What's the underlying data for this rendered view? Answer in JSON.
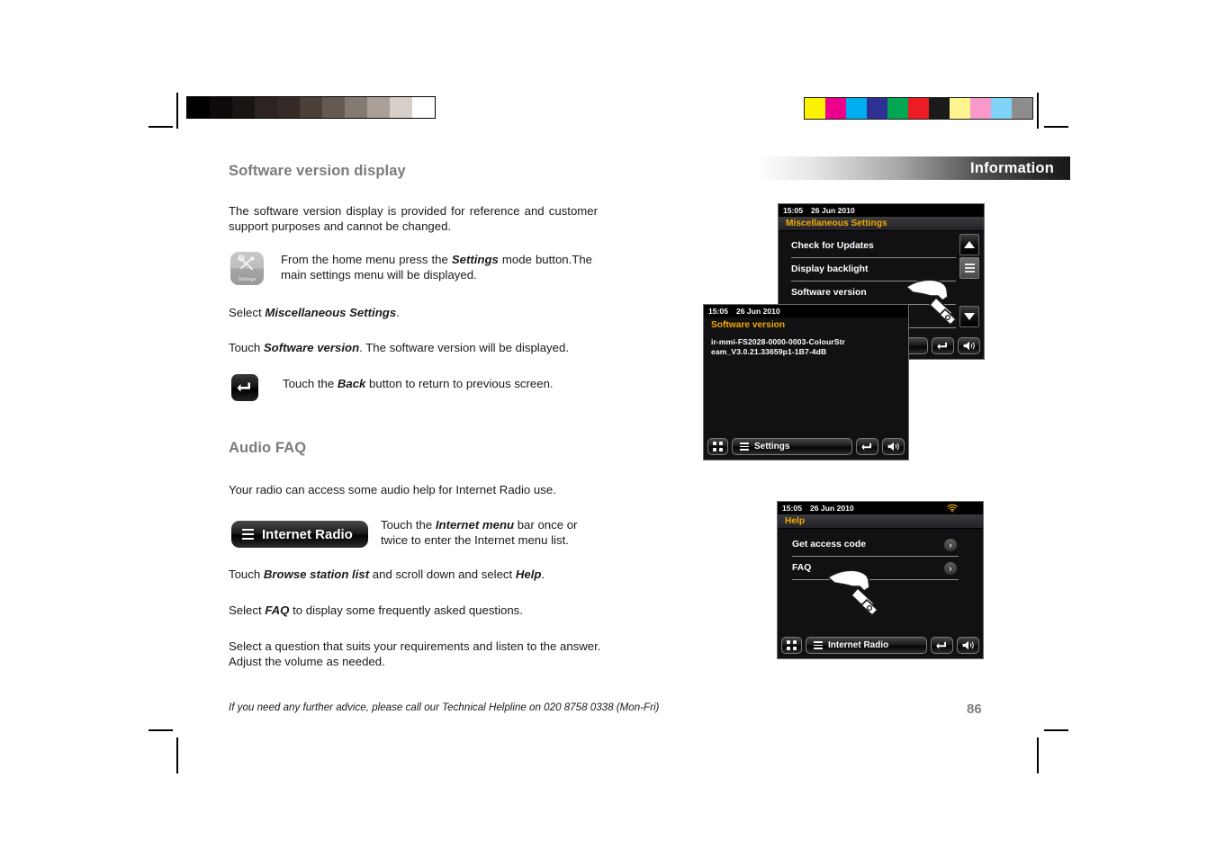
{
  "page": {
    "number": "86",
    "footer_note": "If you need any further advice, please call our Technical Helpline on 020 8758 0338 (Mon-Fri)",
    "section_header": "Information"
  },
  "calibration": {
    "grayscale": [
      "#000000",
      "#0d0a09",
      "#1a1512",
      "#2b2420",
      "#342b26",
      "#4b4038",
      "#645a52",
      "#837a72",
      "#a8a099",
      "#d6cfc9",
      "#ffffff"
    ],
    "colors": [
      "#fff200",
      "#ec008c",
      "#00aeef",
      "#2e3192",
      "#00a651",
      "#ed1c24",
      "#1a1a1a",
      "#fff58f",
      "#f89ac9",
      "#7ed3f7",
      "#8d8d8d"
    ]
  },
  "left_column": {
    "heading_1": "Software version display",
    "intro_paragraph": "The software version display is provided for reference and customer support purposes and cannot be changed.",
    "settings_step": {
      "icon_label": "Settings",
      "text_before": "From the home menu press the ",
      "bold": "Settings",
      "text_after": " mode button.The main settings menu will be displayed."
    },
    "select_misc": {
      "text_before": "Select ",
      "bold": "Miscellaneous Settings",
      "text_after": "."
    },
    "touch_software_version": {
      "text_before": "Touch ",
      "bold": "Software version",
      "text_after": ". The software version will be displayed."
    },
    "back_step": {
      "text_before": "Touch the ",
      "bold": "Back",
      "text_after": " button to return to previous screen."
    },
    "heading_2": "Audio FAQ",
    "audio_intro": "Your radio can access some audio help for Internet Radio use.",
    "internet_radio_button": "Internet Radio",
    "internet_menu_step": {
      "text_before": "Touch the ",
      "bold": "Internet menu",
      "text_after": " bar once or twice to enter the Internet menu list."
    },
    "browse_step": {
      "text_before": "Touch ",
      "bold_1": "Browse station list",
      "text_mid": " and scroll down and select ",
      "bold_2": "Help",
      "text_after": "."
    },
    "faq_step": {
      "text_before": "Select ",
      "bold": "FAQ",
      "text_after": " to display some frequently asked questions."
    },
    "question_step": "Select a question that suits your requirements and listen to the answer. Adjust the volume as needed."
  },
  "screens": {
    "misc_settings": {
      "status_time": "15:05",
      "status_date": "26 Jun 2010",
      "title": "Miscellaneous Settings",
      "items": [
        "Check for Updates",
        "Display backlight",
        "Software version"
      ],
      "scroll_up": "▲",
      "scroll_menu": "menu-icon",
      "scroll_down": "▼"
    },
    "software_version": {
      "status_time": "15:05",
      "status_date": "26 Jun 2010",
      "title": "Software version",
      "version_line_1": "ir-mmi-FS2028-0000-0003-ColourStr",
      "version_line_2": "eam_V3.0.21.33659p1-1B7-4dB",
      "toolbar": {
        "home": "grid-icon",
        "mode_label": "Settings",
        "back": "back-icon",
        "volume": "volume-icon"
      }
    },
    "help": {
      "status_time": "15:05",
      "status_date": "26 Jun 2010",
      "wifi": "wifi-icon",
      "title": "Help",
      "items": [
        "Get access code",
        "FAQ"
      ],
      "chevron": "›",
      "toolbar": {
        "home": "grid-icon",
        "mode_label": "Internet Radio",
        "back": "back-icon",
        "volume": "volume-icon"
      }
    }
  },
  "colors": {
    "heading_gray": "#7b7b7b",
    "screen_title_amber": "#f0a900",
    "wifi_amber": "#e8a900",
    "page_number_gray": "#808080"
  }
}
